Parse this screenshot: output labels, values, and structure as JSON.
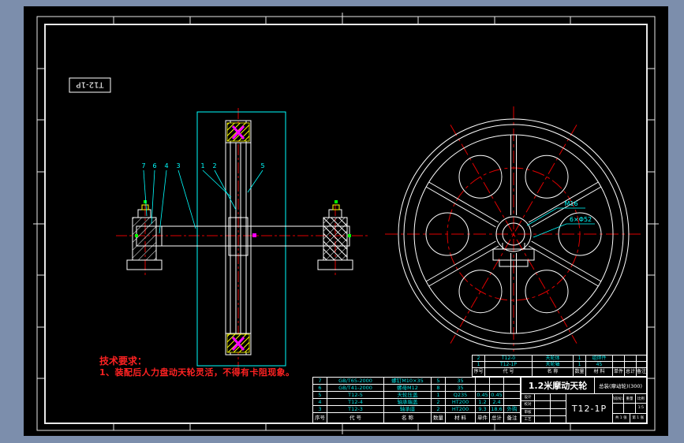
{
  "colors": {
    "workspace_background": "#7c8eac",
    "sheet_background": "#000000",
    "line": "#ffffff",
    "centerline_red": "#e00000",
    "dimension_cyan": "#00ffff",
    "hatch_yellow": "#ffff00",
    "rope_mark_magenta": "#ff00ff",
    "note_red": "#ff2222",
    "grip_green": "#00ff00"
  },
  "corner_label": "T12-1P",
  "tech_requirements": {
    "title": "技术要求：",
    "item_1": "1、装配后人力盘动天轮灵活，不得有卡阻现象。"
  },
  "balloons": {
    "b1": "1",
    "b2": "2",
    "b3": "3",
    "b4": "4",
    "b5": "5",
    "b6": "6",
    "b7": "7"
  },
  "callouts": {
    "hub_bolt": "M16",
    "rim_holes": "6×Φ52"
  },
  "upper_list": {
    "header": [
      "序号",
      "代  号",
      "名  称",
      "数量",
      "材  料",
      "单件",
      "总计",
      "备注"
    ],
    "rows": [
      [
        "2",
        "T12-0",
        "天轮体",
        "1",
        "组焊件",
        "",
        "",
        ""
      ],
      [
        "1",
        "T12-1P",
        "天轮轴",
        "1",
        "45",
        "",
        "",
        ""
      ]
    ]
  },
  "parts_list": {
    "header": [
      "序号",
      "代  号",
      "名  称",
      "数量",
      "材  料",
      "单件",
      "总计",
      "备注"
    ],
    "rows": [
      [
        "7",
        "GB/T65-2000",
        "螺钉M10×35",
        "5",
        "35",
        "",
        "",
        ""
      ],
      [
        "6",
        "GB/T41-2000",
        "螺母M12",
        "8",
        "35",
        "",
        "",
        ""
      ],
      [
        "5",
        "T12-5",
        "天轮压盖",
        "1",
        "Q235",
        "0.45",
        "0.45",
        ""
      ],
      [
        "4",
        "T12-4",
        "轴承端盖",
        "2",
        "HT200",
        "1.2",
        "2.4",
        ""
      ],
      [
        "3",
        "T12-3",
        "轴承座",
        "2",
        "HT200",
        "9.3",
        "18.6",
        "外购"
      ]
    ]
  },
  "title_block": {
    "product_title": "1.2米摩动天轮",
    "assembly_note": "总装(摩动轮)(300)",
    "drawing_number": "T12-1P",
    "sign_labels": [
      "设计",
      "校对",
      "审核",
      "工艺"
    ],
    "stage_label": "阶段标记",
    "weight_label": "重量",
    "scale_label": "比例",
    "scale_value": "1:5",
    "sheet_total": "共 1 张",
    "sheet_no": "第 1 张"
  }
}
